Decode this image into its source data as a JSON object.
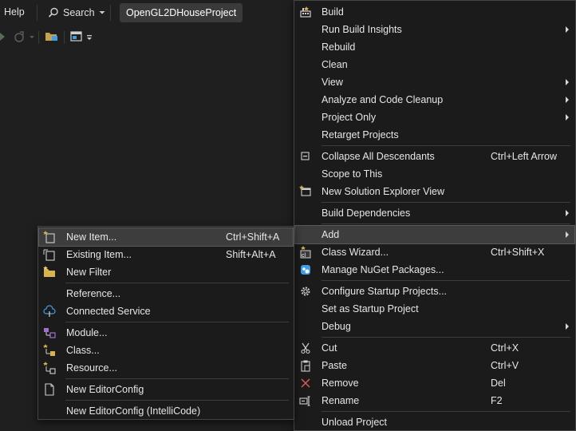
{
  "menubar": {
    "help": "Help",
    "search": "Search",
    "project": "OpenGL2DHouseProject"
  },
  "context_menu": {
    "items": [
      {
        "label": "Build",
        "shortcut": "",
        "submenu": false
      },
      {
        "label": "Run Build Insights",
        "shortcut": "",
        "submenu": true
      },
      {
        "label": "Rebuild",
        "shortcut": "",
        "submenu": false
      },
      {
        "label": "Clean",
        "shortcut": "",
        "submenu": false
      },
      {
        "label": "View",
        "shortcut": "",
        "submenu": true
      },
      {
        "label": "Analyze and Code Cleanup",
        "shortcut": "",
        "submenu": true
      },
      {
        "label": "Project Only",
        "shortcut": "",
        "submenu": true
      },
      {
        "label": "Retarget Projects",
        "shortcut": "",
        "submenu": false
      },
      {
        "label": "Collapse All Descendants",
        "shortcut": "Ctrl+Left Arrow",
        "submenu": false
      },
      {
        "label": "Scope to This",
        "shortcut": "",
        "submenu": false
      },
      {
        "label": "New Solution Explorer View",
        "shortcut": "",
        "submenu": false
      },
      {
        "label": "Build Dependencies",
        "shortcut": "",
        "submenu": true
      },
      {
        "label": "Add",
        "shortcut": "",
        "submenu": true
      },
      {
        "label": "Class Wizard...",
        "shortcut": "Ctrl+Shift+X",
        "submenu": false
      },
      {
        "label": "Manage NuGet Packages...",
        "shortcut": "",
        "submenu": false
      },
      {
        "label": "Configure Startup Projects...",
        "shortcut": "",
        "submenu": false
      },
      {
        "label": "Set as Startup Project",
        "shortcut": "",
        "submenu": false
      },
      {
        "label": "Debug",
        "shortcut": "",
        "submenu": true
      },
      {
        "label": "Cut",
        "shortcut": "Ctrl+X",
        "submenu": false
      },
      {
        "label": "Paste",
        "shortcut": "Ctrl+V",
        "submenu": false
      },
      {
        "label": "Remove",
        "shortcut": "Del",
        "submenu": false
      },
      {
        "label": "Rename",
        "shortcut": "F2",
        "submenu": false
      },
      {
        "label": "Unload Project",
        "shortcut": "",
        "submenu": false
      }
    ]
  },
  "add_submenu": {
    "items": [
      {
        "label": "New Item...",
        "shortcut": "Ctrl+Shift+A"
      },
      {
        "label": "Existing Item...",
        "shortcut": "Shift+Alt+A"
      },
      {
        "label": "New Filter",
        "shortcut": ""
      },
      {
        "label": "Reference...",
        "shortcut": ""
      },
      {
        "label": "Connected Service",
        "shortcut": ""
      },
      {
        "label": "Module...",
        "shortcut": ""
      },
      {
        "label": "Class...",
        "shortcut": ""
      },
      {
        "label": "Resource...",
        "shortcut": ""
      },
      {
        "label": "New EditorConfig",
        "shortcut": ""
      },
      {
        "label": "New EditorConfig (IntelliCode)",
        "shortcut": ""
      }
    ]
  },
  "colors": {
    "background": "#1f1f1f",
    "menu_bg": "#1b1b1b",
    "highlight": "#3d3d3d",
    "icon_blue": "#3e9ee8",
    "icon_yellow": "#d8b24a",
    "icon_red": "#e05a5a"
  }
}
